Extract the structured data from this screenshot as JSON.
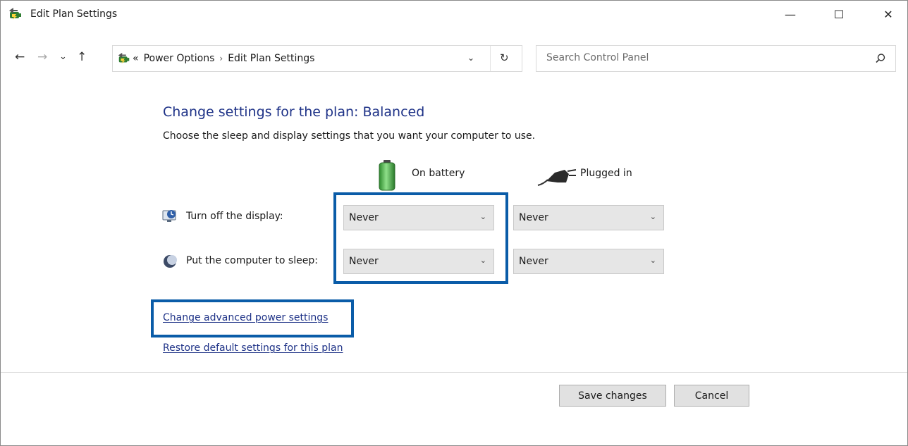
{
  "window": {
    "title": "Edit Plan Settings",
    "controls": {
      "minimize": "—",
      "maximize": "☐",
      "close": "✕"
    }
  },
  "nav": {
    "back": "←",
    "forward": "→",
    "recent": "⌄",
    "up": "↑",
    "breadcrumb_overflow": "«",
    "breadcrumbs": [
      "Power Options",
      "Edit Plan Settings"
    ],
    "breadcrumb_sep": "›",
    "dropdown": "⌄",
    "refresh": "↻"
  },
  "search": {
    "placeholder": "Search Control Panel"
  },
  "content": {
    "heading": "Change settings for the plan: Balanced",
    "subtitle": "Choose the sleep and display settings that you want your computer to use.",
    "col_battery": "On battery",
    "col_plugged": "Plugged in",
    "rows": [
      {
        "label": "Turn off the display:",
        "battery": "Never",
        "plugged": "Never"
      },
      {
        "label": "Put the computer to sleep:",
        "battery": "Never",
        "plugged": "Never"
      }
    ],
    "links": {
      "advanced": "Change advanced power settings",
      "restore": "Restore default settings for this plan"
    }
  },
  "buttons": {
    "save": "Save changes",
    "cancel": "Cancel"
  },
  "colors": {
    "highlight": "#0a5ca8",
    "heading": "#1e3287"
  },
  "icons": {
    "app": "power-options-icon",
    "display": "monitor-clock-icon",
    "sleep": "moon-icon",
    "battery": "battery-icon",
    "plug": "power-plug-icon"
  }
}
